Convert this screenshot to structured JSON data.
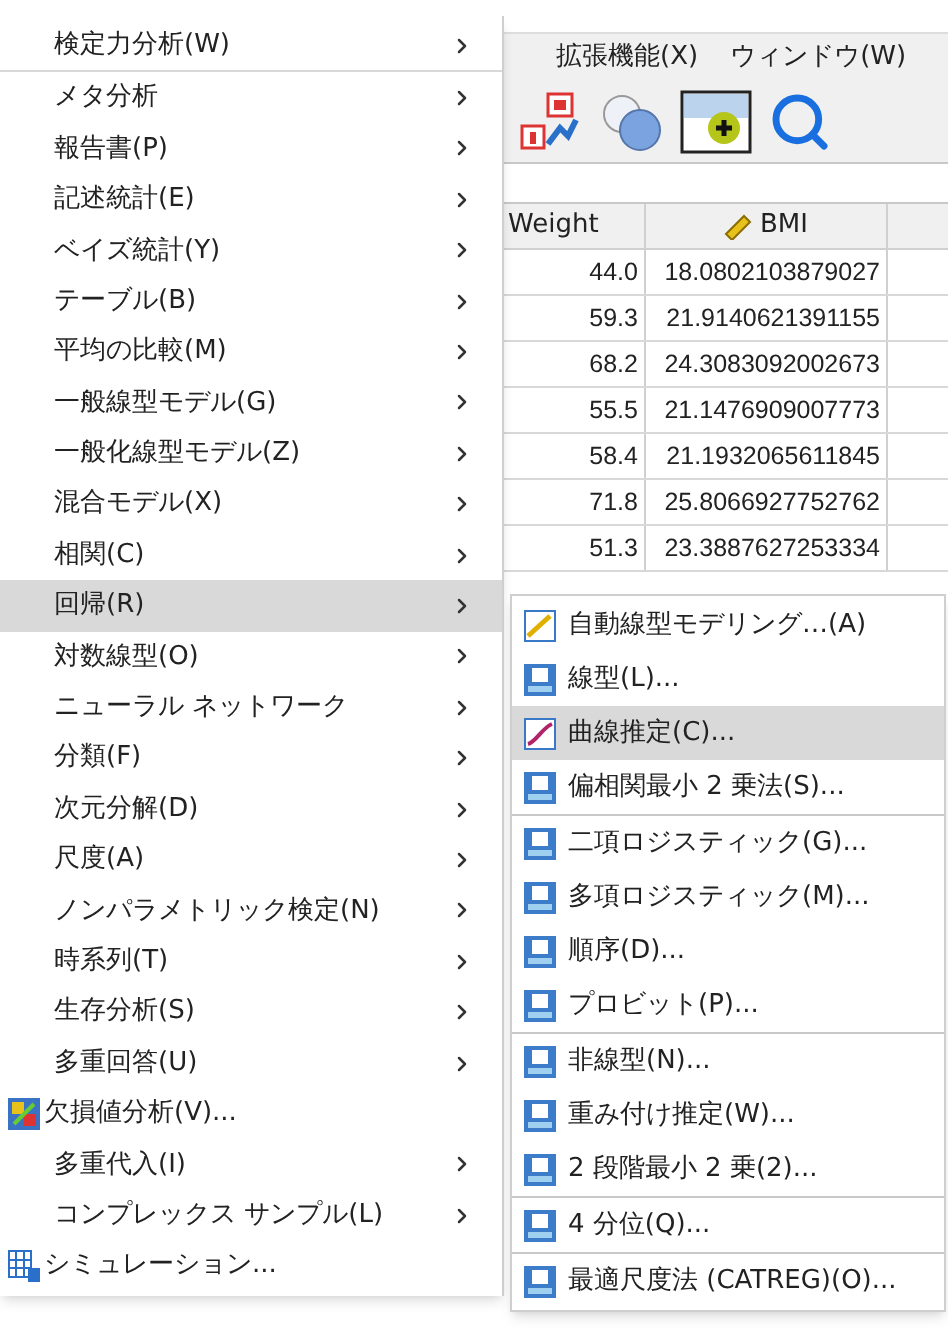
{
  "menubar": [
    {
      "label": "拡張機能(X)"
    },
    {
      "label": "ウィンドウ(W)"
    }
  ],
  "toolbar": [
    {
      "kind": "value-labels"
    },
    {
      "kind": "venn"
    },
    {
      "kind": "select-cases"
    },
    {
      "kind": "search"
    }
  ],
  "grid": {
    "columns": [
      {
        "name": "Weight",
        "kind": "plain"
      },
      {
        "name": "BMI",
        "kind": "scale"
      }
    ],
    "rows": [
      [
        "44.0",
        "18.0802103879027"
      ],
      [
        "59.3",
        "21.9140621391155"
      ],
      [
        "68.2",
        "24.3083092002673"
      ],
      [
        "55.5",
        "21.1476909007773"
      ],
      [
        "58.4",
        "21.1932065611845"
      ],
      [
        "71.8",
        "25.8066927752762"
      ],
      [
        "51.3",
        "23.3887627253334"
      ]
    ]
  },
  "menu": {
    "groups": [
      [
        {
          "label": "検定力分析(W)",
          "kind": "submenu",
          "selected": false
        }
      ],
      [
        {
          "label": "メタ分析",
          "kind": "submenu",
          "selected": false
        },
        {
          "label": "報告書(P)",
          "kind": "submenu",
          "selected": false
        },
        {
          "label": "記述統計(E)",
          "kind": "submenu",
          "selected": false
        },
        {
          "label": "ベイズ統計(Y)",
          "kind": "submenu",
          "selected": false
        },
        {
          "label": "テーブル(B)",
          "kind": "submenu",
          "selected": false
        },
        {
          "label": "平均の比較(M)",
          "kind": "submenu",
          "selected": false
        },
        {
          "label": "一般線型モデル(G)",
          "kind": "submenu",
          "selected": false
        },
        {
          "label": "一般化線型モデル(Z)",
          "kind": "submenu",
          "selected": false
        },
        {
          "label": "混合モデル(X)",
          "kind": "submenu",
          "selected": false
        },
        {
          "label": "相関(C)",
          "kind": "submenu",
          "selected": false
        },
        {
          "label": "回帰(R)",
          "kind": "submenu",
          "selected": true
        },
        {
          "label": "対数線型(O)",
          "kind": "submenu",
          "selected": false
        },
        {
          "label": "ニューラル ネットワーク",
          "kind": "submenu",
          "selected": false
        },
        {
          "label": "分類(F)",
          "kind": "submenu",
          "selected": false
        },
        {
          "label": "次元分解(D)",
          "kind": "submenu",
          "selected": false
        },
        {
          "label": "尺度(A)",
          "kind": "submenu",
          "selected": false
        },
        {
          "label": "ノンパラメトリック検定(N)",
          "kind": "submenu",
          "selected": false
        },
        {
          "label": "時系列(T)",
          "kind": "submenu",
          "selected": false
        },
        {
          "label": "生存分析(S)",
          "kind": "submenu",
          "selected": false
        },
        {
          "label": "多重回答(U)",
          "kind": "submenu",
          "selected": false
        },
        {
          "label": "欠損値分析(V)...",
          "kind": "missing",
          "selected": false
        },
        {
          "label": "多重代入(I)",
          "kind": "submenu",
          "selected": false
        },
        {
          "label": "コンプレックス サンプル(L)",
          "kind": "submenu",
          "selected": false
        },
        {
          "label": "シミュレーション...",
          "kind": "simulation",
          "selected": false
        }
      ]
    ]
  },
  "submenu": {
    "groups": [
      [
        {
          "label": "自動線型モデリング…(A)",
          "kind": "auto",
          "selected": false
        },
        {
          "label": "線型(L)...",
          "kind": "procedure",
          "selected": false
        },
        {
          "label": "曲線推定(C)...",
          "kind": "curve",
          "selected": true
        },
        {
          "label": "偏相関最小 2 乗法(S)...",
          "kind": "procedure",
          "selected": false
        }
      ],
      [
        {
          "label": "二項ロジスティック(G)...",
          "kind": "procedure",
          "selected": false
        },
        {
          "label": "多項ロジスティック(M)...",
          "kind": "procedure",
          "selected": false
        },
        {
          "label": "順序(D)...",
          "kind": "procedure",
          "selected": false
        },
        {
          "label": "プロビット(P)...",
          "kind": "procedure",
          "selected": false
        }
      ],
      [
        {
          "label": "非線型(N)...",
          "kind": "procedure",
          "selected": false
        },
        {
          "label": "重み付け推定(W)...",
          "kind": "procedure",
          "selected": false
        },
        {
          "label": "2 段階最小 2 乗(2)...",
          "kind": "procedure",
          "selected": false
        }
      ],
      [
        {
          "label": "4 分位(Q)...",
          "kind": "procedure",
          "selected": false
        }
      ],
      [
        {
          "label": "最適尺度法 (CATREG)(O)...",
          "kind": "procedure",
          "selected": false
        }
      ]
    ]
  }
}
